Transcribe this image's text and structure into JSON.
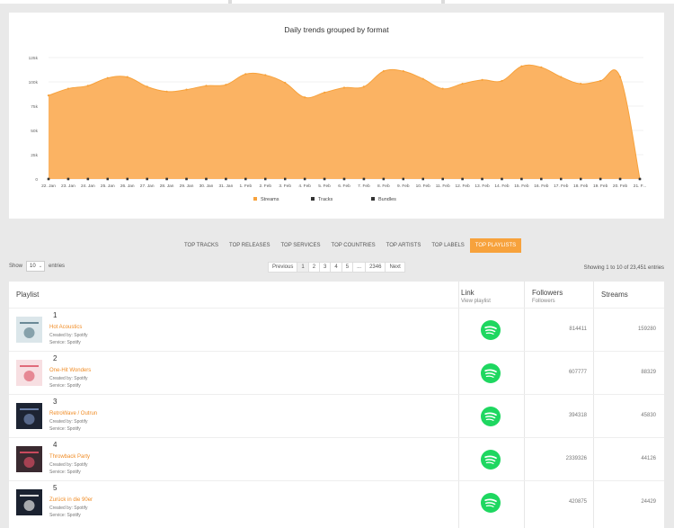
{
  "chart": {
    "title": "Daily trends grouped by format",
    "colors": {
      "streams": "#fbb363",
      "streams_line": "#f7a23c",
      "tracks": "#333333",
      "bundles": "#333333",
      "grid": "#e6e6e6"
    }
  },
  "chart_data": {
    "type": "area",
    "title": "Daily trends grouped by format",
    "xlabel": "",
    "ylabel": "",
    "ylim": [
      0,
      125000
    ],
    "yticks": [
      "0",
      "25k",
      "50k",
      "75k",
      "100k",
      "125k"
    ],
    "grid": true,
    "legend_position": "bottom",
    "categories": [
      "22. Jan",
      "23. Jan",
      "24. Jan",
      "25. Jan",
      "26. Jan",
      "27. Jan",
      "28. Jan",
      "29. Jan",
      "30. Jan",
      "31. Jan",
      "1. Feb",
      "2. Feb",
      "3. Feb",
      "4. Feb",
      "5. Feb",
      "6. Feb",
      "7. Feb",
      "8. Feb",
      "9. Feb",
      "10. Feb",
      "11. Feb",
      "12. Feb",
      "13. Feb",
      "14. Feb",
      "15. Feb",
      "16. Feb",
      "17. Feb",
      "18. Feb",
      "19. Feb",
      "20. Feb",
      "21. F..."
    ],
    "series": [
      {
        "name": "Streams",
        "values": [
          86000,
          93000,
          96000,
          104000,
          105000,
          95000,
          90000,
          92000,
          96000,
          97000,
          108000,
          107000,
          99000,
          84000,
          89000,
          94000,
          95000,
          111000,
          111000,
          103000,
          93000,
          98000,
          102000,
          101000,
          116000,
          115000,
          105000,
          98000,
          101000,
          105000,
          0
        ]
      },
      {
        "name": "Tracks",
        "values": [
          0,
          0,
          0,
          0,
          0,
          0,
          0,
          0,
          0,
          0,
          0,
          0,
          0,
          0,
          0,
          0,
          0,
          0,
          0,
          0,
          0,
          0,
          0,
          0,
          0,
          0,
          0,
          0,
          0,
          0,
          0
        ]
      },
      {
        "name": "Bundles",
        "values": [
          0,
          0,
          0,
          0,
          0,
          0,
          0,
          0,
          0,
          0,
          0,
          0,
          0,
          0,
          0,
          0,
          0,
          0,
          0,
          0,
          0,
          0,
          0,
          0,
          0,
          0,
          0,
          0,
          0,
          0,
          0
        ]
      }
    ]
  },
  "tabs": [
    {
      "label": "TOP TRACKS",
      "active": false
    },
    {
      "label": "TOP RELEASES",
      "active": false
    },
    {
      "label": "TOP SERVICES",
      "active": false
    },
    {
      "label": "TOP COUNTRIES",
      "active": false
    },
    {
      "label": "TOP ARTISTS",
      "active": false
    },
    {
      "label": "TOP LABELS",
      "active": false
    },
    {
      "label": "TOP PLAYLISTS",
      "active": true
    }
  ],
  "length_ctrl": {
    "show": "Show",
    "value": "10",
    "entries": "entries"
  },
  "pagination": {
    "previous": "Previous",
    "pages": [
      "1",
      "2",
      "3",
      "4",
      "5",
      "...",
      "2346"
    ],
    "next": "Next"
  },
  "info": "Showing 1 to 10 of 23,451 entries",
  "table": {
    "headers": {
      "playlist": "Playlist",
      "link": "Link",
      "link_sub": "View playlist",
      "followers": "Followers",
      "followers_sub": "Followers",
      "streams": "Streams"
    },
    "rows": [
      {
        "rank": "1",
        "name": "Hot Acoustics",
        "created": "Created by: Spotify",
        "service": "Service: Spotify",
        "followers": "814411",
        "streams": "159280",
        "thumb": "#dbe6ea",
        "thumb_accent": "#6a8996"
      },
      {
        "rank": "2",
        "name": "One-Hit Wonders",
        "created": "Created by: Spotify",
        "service": "Service: Spotify",
        "followers": "607777",
        "streams": "88329",
        "thumb": "#f7dfe2",
        "thumb_accent": "#e06b7a"
      },
      {
        "rank": "3",
        "name": "RetroWave / Outrun",
        "created": "Created by: Spotify",
        "service": "Service: Spotify",
        "followers": "394318",
        "streams": "45830",
        "thumb": "#1d2433",
        "thumb_accent": "#6b7fa8"
      },
      {
        "rank": "4",
        "name": "Throwback Party",
        "created": "Created by: Spotify",
        "service": "Service: Spotify",
        "followers": "2339326",
        "streams": "44126",
        "thumb": "#3a2a30",
        "thumb_accent": "#c94a5d"
      },
      {
        "rank": "5",
        "name": "Zurück in die 90er",
        "created": "Created by: Spotify",
        "service": "Service: Spotify",
        "followers": "420875",
        "streams": "24429",
        "thumb": "#1b2230",
        "thumb_accent": "#d8d8d8"
      }
    ]
  },
  "icons": {
    "link": "spotify-icon"
  }
}
